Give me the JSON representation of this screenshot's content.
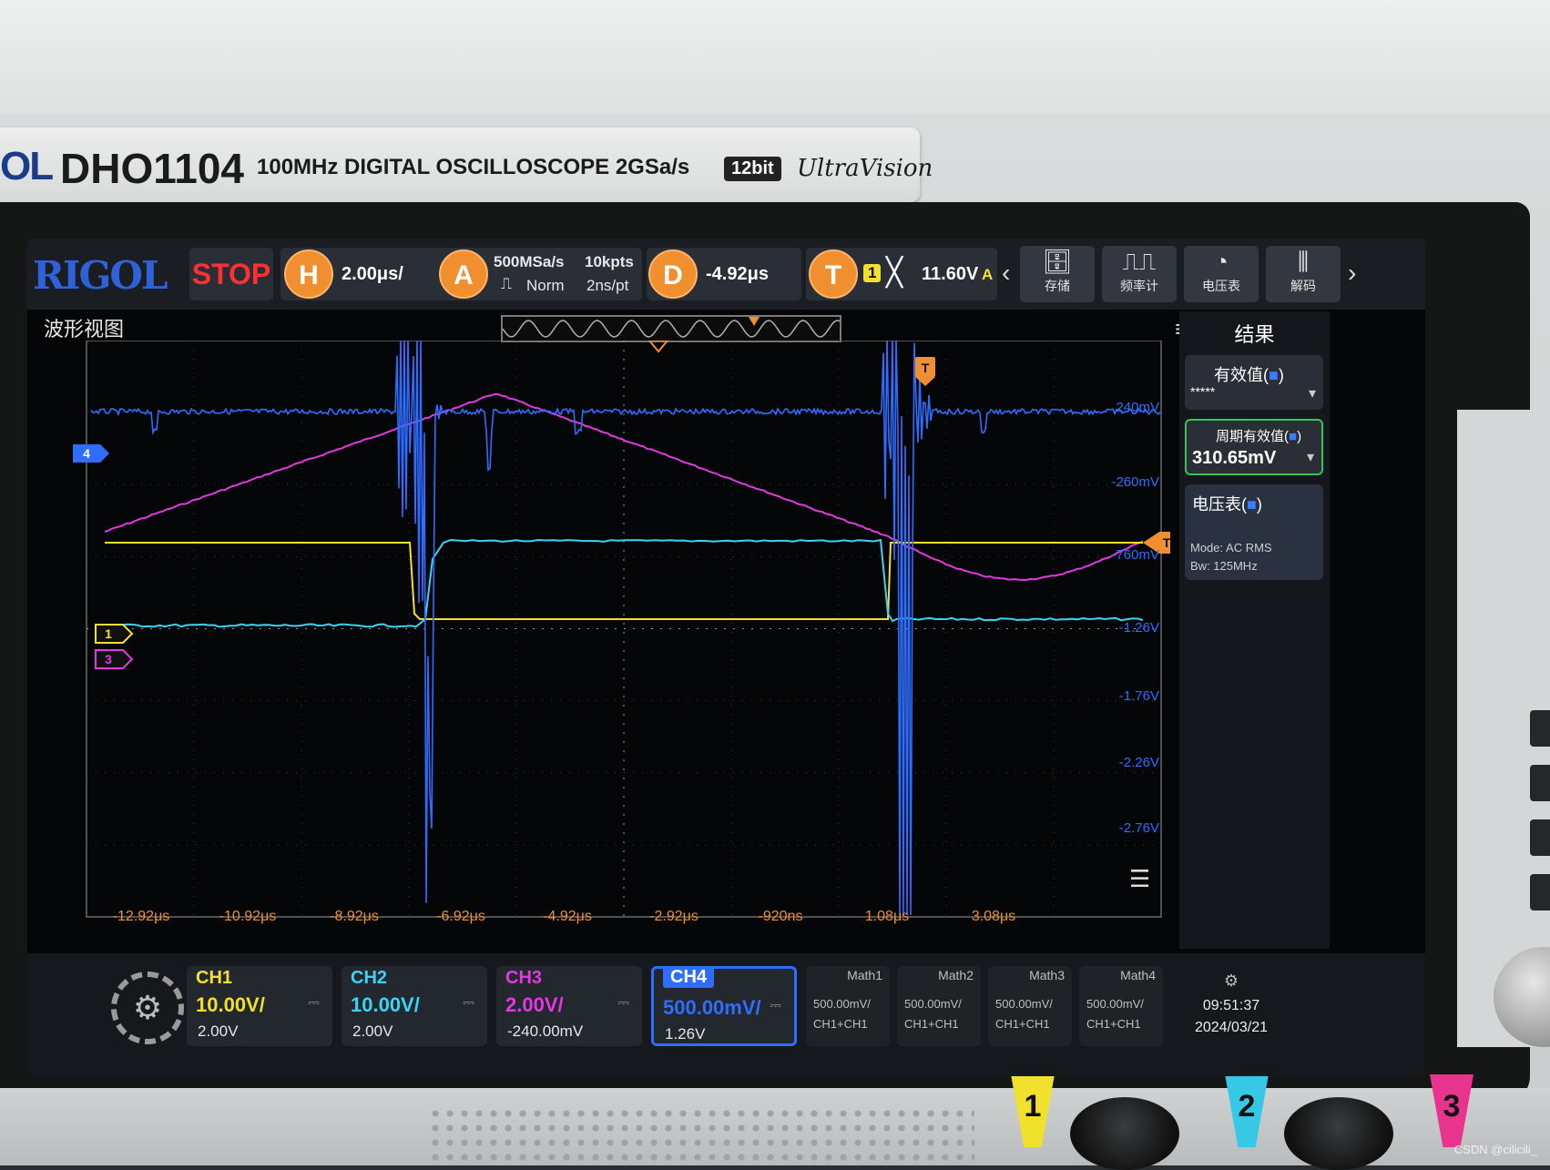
{
  "device": {
    "brand_fragment": "OL",
    "model": "DHO1104",
    "spec": "100MHz  DIGITAL OSCILLOSCOPE  2GSa/s",
    "bit_badge": "12bit",
    "ultravision": "UltraVision"
  },
  "toolbar": {
    "logo": "RIGOL",
    "run_state": "STOP",
    "horizontal": {
      "key": "H",
      "scale": "2.00μs/"
    },
    "acquire": {
      "key": "A",
      "sample_rate": "500MSa/s",
      "mode": "Norm",
      "memory_depth": "10kpts",
      "resolution": "2ns/pt"
    },
    "delay": {
      "key": "D",
      "value": "-4.92μs"
    },
    "trigger": {
      "key": "T",
      "source": "1",
      "level": "11.60V",
      "mode": "A"
    },
    "functions": [
      {
        "label": "存储",
        "icon": "save-icon"
      },
      {
        "label": "频率计",
        "icon": "counter-icon"
      },
      {
        "label": "电压表",
        "icon": "voltmeter-icon"
      },
      {
        "label": "解码",
        "icon": "decode-icon"
      }
    ]
  },
  "waveform_view": {
    "title": "波形视图",
    "right_axis_labels": [
      "240mV",
      "-260mV",
      "-760mV",
      "-1.26V",
      "-1.76V",
      "-2.26V",
      "-2.76V"
    ],
    "time_axis_labels": [
      "-12.92μs",
      "-10.92μs",
      "-8.92μs",
      "-6.92μs",
      "-4.92μs",
      "-2.92μs",
      "-920ns",
      "1.08μs",
      "3.08μs"
    ],
    "channel_markers": {
      "ch4": "4",
      "ch1": "1",
      "ch3": "3",
      "trigger": "T"
    }
  },
  "results": {
    "title": "结果",
    "cards": [
      {
        "name": "有效值(",
        "suffix": ")",
        "value": "*****"
      },
      {
        "name": "周期有效值(",
        "suffix": ")",
        "value": "310.65mV"
      },
      {
        "name": "电压表(",
        "suffix": ")",
        "mode": "Mode:  AC RMS",
        "bw": "Bw:     125MHz"
      }
    ]
  },
  "channels": [
    {
      "name": "CH1",
      "scale": "10.00V/",
      "offset": "2.00V",
      "color": "#f2e12c"
    },
    {
      "name": "CH2",
      "scale": "10.00V/",
      "offset": "2.00V",
      "color": "#3ed3f2"
    },
    {
      "name": "CH3",
      "scale": "2.00V/",
      "offset": "-240.00mV",
      "color": "#e23ae0"
    },
    {
      "name": "CH4",
      "scale": "500.00mV/",
      "offset": "1.26V",
      "color": "#2f6dff"
    }
  ],
  "math": [
    {
      "name": "Math1",
      "scale": "500.00mV/",
      "source": "CH1+CH1"
    },
    {
      "name": "Math2",
      "scale": "500.00mV/",
      "source": "CH1+CH1"
    },
    {
      "name": "Math3",
      "scale": "500.00mV/",
      "source": "CH1+CH1"
    },
    {
      "name": "Math4",
      "scale": "500.00mV/",
      "source": "CH1+CH1"
    }
  ],
  "clock": {
    "time": "09:51:37",
    "date": "2024/03/21"
  },
  "front_panel": {
    "inputs": [
      "1",
      "2",
      "3"
    ]
  },
  "watermark": "CSDN @cilicili_"
}
